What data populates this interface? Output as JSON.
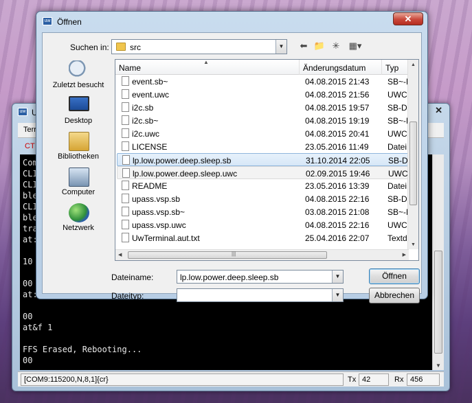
{
  "terminal": {
    "title": "U",
    "tab_label": "Terr",
    "ctrl_label": "CT",
    "lines": [
      "Com",
      "CLI",
      "CLI",
      "ble",
      "CLI",
      "ble",
      "tra",
      "at:",
      "",
      "10",
      "",
      "00",
      "at:",
      "",
      "00",
      "at&f 1",
      "",
      "FFS Erased, Rebooting...",
      "00"
    ],
    "status": {
      "port": "[COM9:115200,N,8,1]{cr}",
      "tx_label": "Tx",
      "tx_value": "42",
      "rx_label": "Rx",
      "rx_value": "456"
    }
  },
  "dialog": {
    "title": "Öffnen",
    "close_glyph": "✕",
    "lookin_label": "Suchen in:",
    "lookin_value": "src",
    "places": [
      {
        "label": "Zuletzt besucht",
        "icon": "recent-places-icon"
      },
      {
        "label": "Desktop",
        "icon": "desktop-icon"
      },
      {
        "label": "Bibliotheken",
        "icon": "libraries-icon"
      },
      {
        "label": "Computer",
        "icon": "computer-icon"
      },
      {
        "label": "Netzwerk",
        "icon": "network-icon"
      }
    ],
    "columns": {
      "name": "Name",
      "date": "Änderungsdatum",
      "type": "Typ"
    },
    "files": [
      {
        "name": "event.sb~",
        "date": "04.08.2015 21:43",
        "type": "SB~-Datei"
      },
      {
        "name": "event.uwc",
        "date": "04.08.2015 21:56",
        "type": "UWC-Datei"
      },
      {
        "name": "i2c.sb",
        "date": "04.08.2015 19:57",
        "type": "SB-Datei"
      },
      {
        "name": "i2c.sb~",
        "date": "04.08.2015 19:19",
        "type": "SB~-Datei"
      },
      {
        "name": "i2c.uwc",
        "date": "04.08.2015 20:41",
        "type": "UWC-Datei"
      },
      {
        "name": "LICENSE",
        "date": "23.05.2016 11:49",
        "type": "Datei"
      },
      {
        "name": "lp.low.power.deep.sleep.sb",
        "date": "31.10.2014 22:05",
        "type": "SB-Datei"
      },
      {
        "name": "lp.low.power.deep.sleep.uwc",
        "date": "02.09.2015 19:46",
        "type": "UWC-Datei"
      },
      {
        "name": "README",
        "date": "23.05.2016 13:39",
        "type": "Datei"
      },
      {
        "name": "upass.vsp.sb",
        "date": "04.08.2015 22:16",
        "type": "SB-Datei"
      },
      {
        "name": "upass.vsp.sb~",
        "date": "03.08.2015 21:08",
        "type": "SB~-Datei"
      },
      {
        "name": "upass.vsp.uwc",
        "date": "04.08.2015 22:16",
        "type": "UWC-Datei"
      },
      {
        "name": "UwTerminal.aut.txt",
        "date": "25.04.2016 22:07",
        "type": "Textdokument"
      }
    ],
    "selected_index": 6,
    "hover_index": 7,
    "filename_label": "Dateiname:",
    "filename_value": "lp.low.power.deep.sleep.sb",
    "filetype_label": "Dateityp:",
    "filetype_value": "",
    "open_button": "Öffnen",
    "cancel_button": "Abbrechen"
  }
}
